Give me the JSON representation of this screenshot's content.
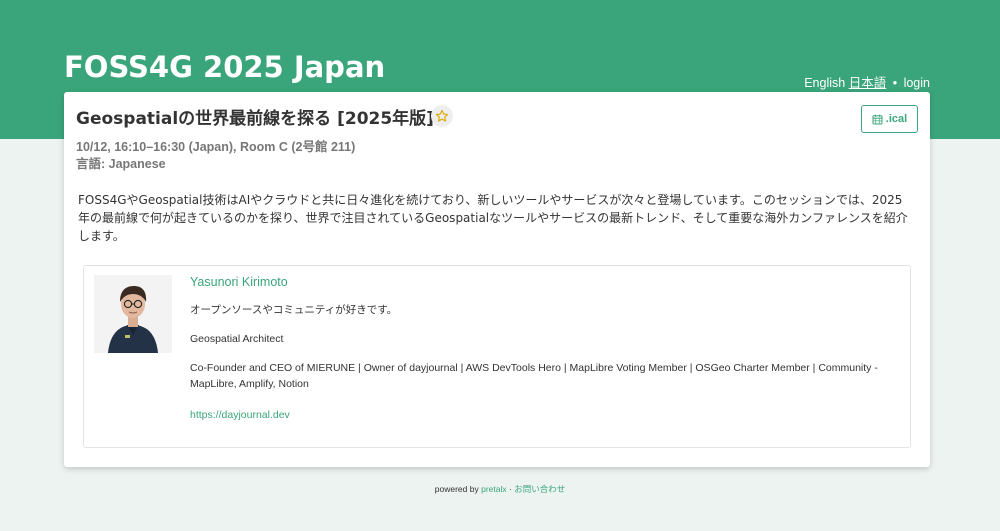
{
  "header": {
    "site_title": "FOSS4G 2025 Japan",
    "nav": {
      "english": "English",
      "japanese": "日本語",
      "separator": "•",
      "login": "login"
    }
  },
  "talk": {
    "title": "Geospatialの世界最前線を探る [2025年版]",
    "favorite_icon": "star-icon",
    "ical_label": ".ical",
    "ical_icon": "calendar-icon",
    "time_room": "10/12, 16:10–16:30 (Japan), Room C (2号館 211)",
    "language": "言語: Japanese",
    "abstract": "FOSS4GやGeospatial技術はAIやクラウドと共に日々進化を続けており、新しいツールやサービスが次々と登場しています。このセッションでは、2025年の最前線で何が起きているのかを探り、世界で注目されているGeospatialなツールやサービスの最新トレンド、そして重要な海外カンファレンスを紹介します。"
  },
  "speaker": {
    "name": "Yasunori Kirimoto",
    "bio_1": "オープンソースやコミュニティが好きです。",
    "bio_2": "Geospatial Architect",
    "bio_3": "Co-Founder and CEO of MIERUNE | Owner of dayjournal | AWS DevTools Hero | MapLibre Voting Member | OSGeo Charter Member | Community - MapLibre, Amplify, Notion",
    "link": "https://dayjournal.dev"
  },
  "footer": {
    "powered_by": "powered by",
    "pretalx": "pretalx",
    "separator": "·",
    "contact": "お問い合わせ"
  },
  "colors": {
    "brand": "#3aa57a",
    "star": "#e0a800"
  }
}
